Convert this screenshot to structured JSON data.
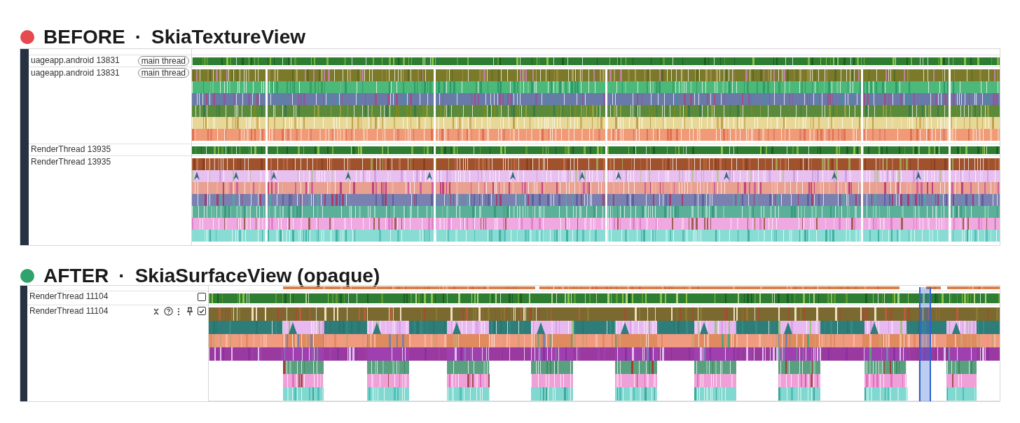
{
  "panels": [
    {
      "heading": "BEFORE",
      "separator": "·",
      "subject": "SkiaTextureView",
      "color": "#e5484d",
      "tracks": [
        {
          "kind": "summary",
          "name": "uageapp.android 13831",
          "tag": "main thread"
        },
        {
          "kind": "slices",
          "name": "uageapp.android 13831",
          "tag": "main thread"
        },
        {
          "kind": "summary",
          "name": "RenderThread 13935"
        },
        {
          "kind": "slices",
          "name": "RenderThread 13935"
        }
      ]
    },
    {
      "heading": "AFTER",
      "separator": "·",
      "subject": "SkiaSurfaceView (opaque)",
      "color": "#2fa36b",
      "tracks": [
        {
          "kind": "summary",
          "name": "RenderThread 11104",
          "checked": false,
          "hovered": false
        },
        {
          "kind": "slices",
          "name": "RenderThread 11104",
          "checked": true,
          "hovered": true
        }
      ]
    }
  ]
}
